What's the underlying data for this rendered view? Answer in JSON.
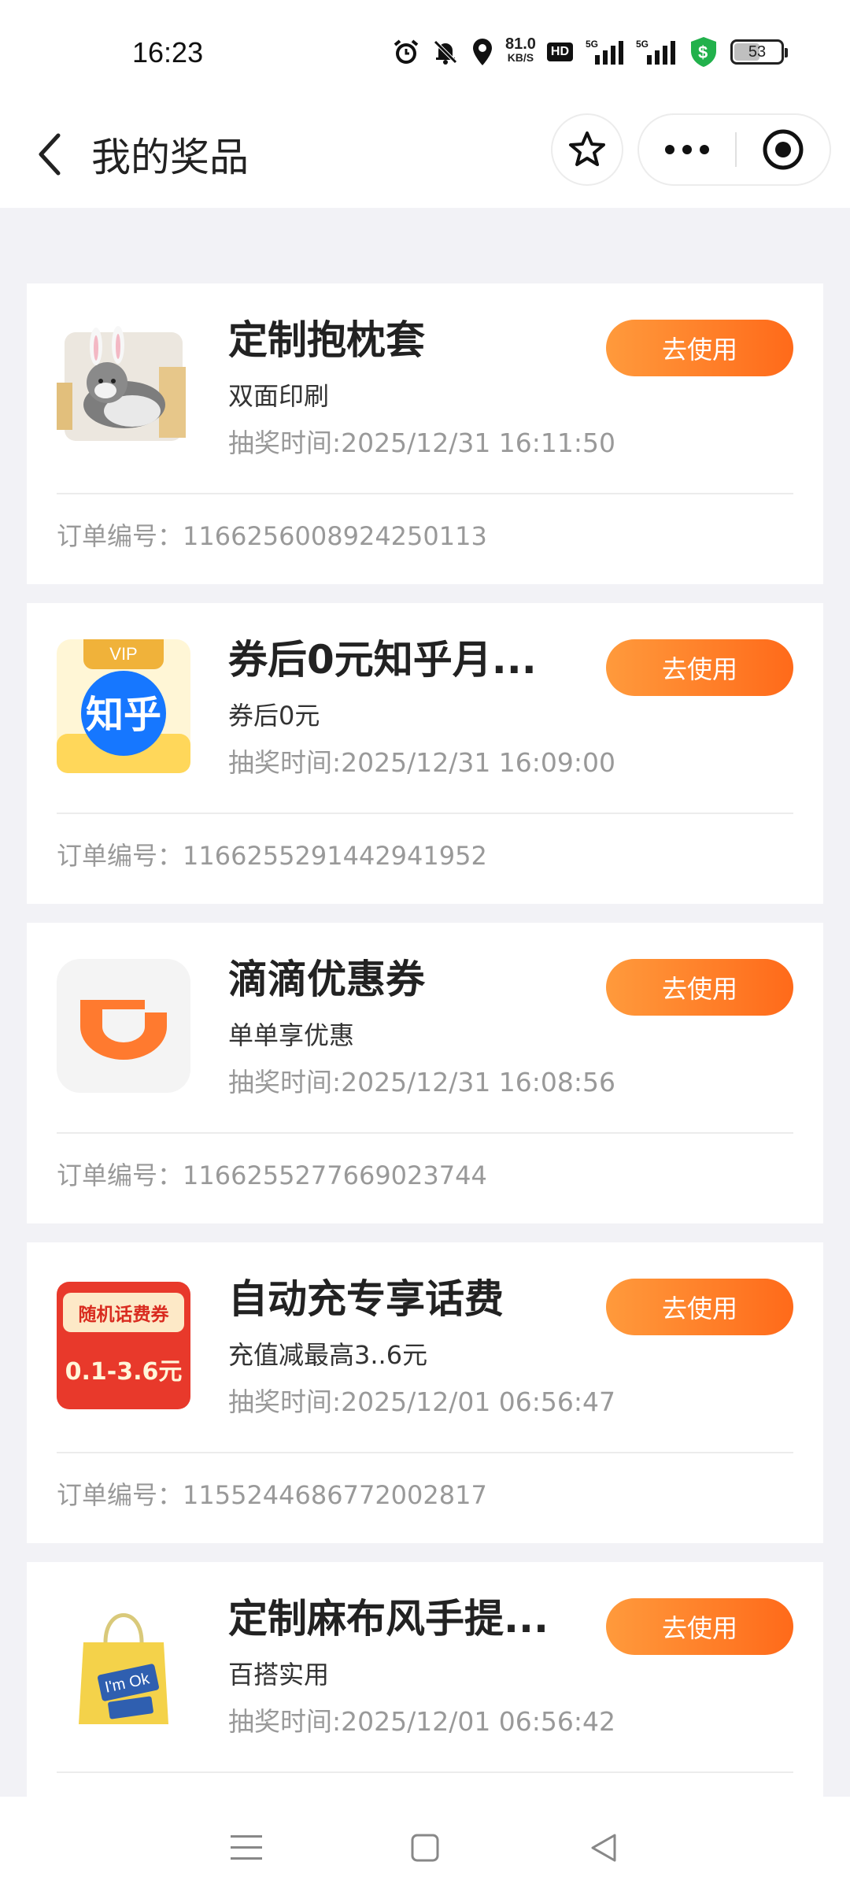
{
  "status_bar": {
    "time": "16:23",
    "net_speed_value": "81.0",
    "net_speed_unit": "KB/S",
    "hd_label": "HD",
    "battery": "53",
    "icons": [
      "alarm-icon",
      "mute-icon",
      "location-icon",
      "hd-icon",
      "5g-signal-icon",
      "5g-signal-icon",
      "shield-dollar-icon",
      "battery-icon"
    ]
  },
  "header": {
    "title": "我的奖品",
    "back_icon": "chevron-left-icon",
    "favorite_icon": "star-icon",
    "more_icon": "more-dots-icon",
    "close_icon": "target-circle-icon"
  },
  "prizes": [
    {
      "title": "定制抱枕套",
      "subtitle": "双面印刷",
      "time": "抽奖时间:2025/12/31 16:11:50",
      "button": "去使用",
      "order": "订单编号：1166256008924250113",
      "image": "pillow-cat-image"
    },
    {
      "title": "券后0元知乎月...",
      "subtitle": "券后0元",
      "time": "抽奖时间:2025/12/31 16:09:00",
      "button": "去使用",
      "order": "订单编号：1166255291442941952",
      "image": "zhihu-vip-logo",
      "badge_vip": "VIP",
      "badge_name": "知乎"
    },
    {
      "title": "滴滴优惠券",
      "subtitle": "单单享优惠",
      "time": "抽奖时间:2025/12/31 16:08:56",
      "button": "去使用",
      "order": "订单编号：1166255277669023744",
      "image": "didi-logo"
    },
    {
      "title": "自动充专享话费",
      "subtitle": "充值减最高3..6元",
      "time": "抽奖时间:2025/12/01 06:56:47",
      "button": "去使用",
      "order": "订单编号：1155244686772002817",
      "image": "phone-bill-coupon",
      "coupon_top": "随机话费券",
      "coupon_amount": "0.1-3.6元"
    },
    {
      "title": "定制麻布风手提...",
      "subtitle": "百搭实用",
      "time": "抽奖时间:2025/12/01 06:56:42",
      "button": "去使用",
      "order": "",
      "image": "tote-bag-image",
      "bag_text": "I'm Ok"
    }
  ],
  "colors": {
    "accent_start": "#ff9a3c",
    "accent_end": "#ff6a1a",
    "page_bg": "#f2f2f6"
  },
  "system_nav": [
    "menu-icon",
    "home-square-icon",
    "back-triangle-icon"
  ]
}
